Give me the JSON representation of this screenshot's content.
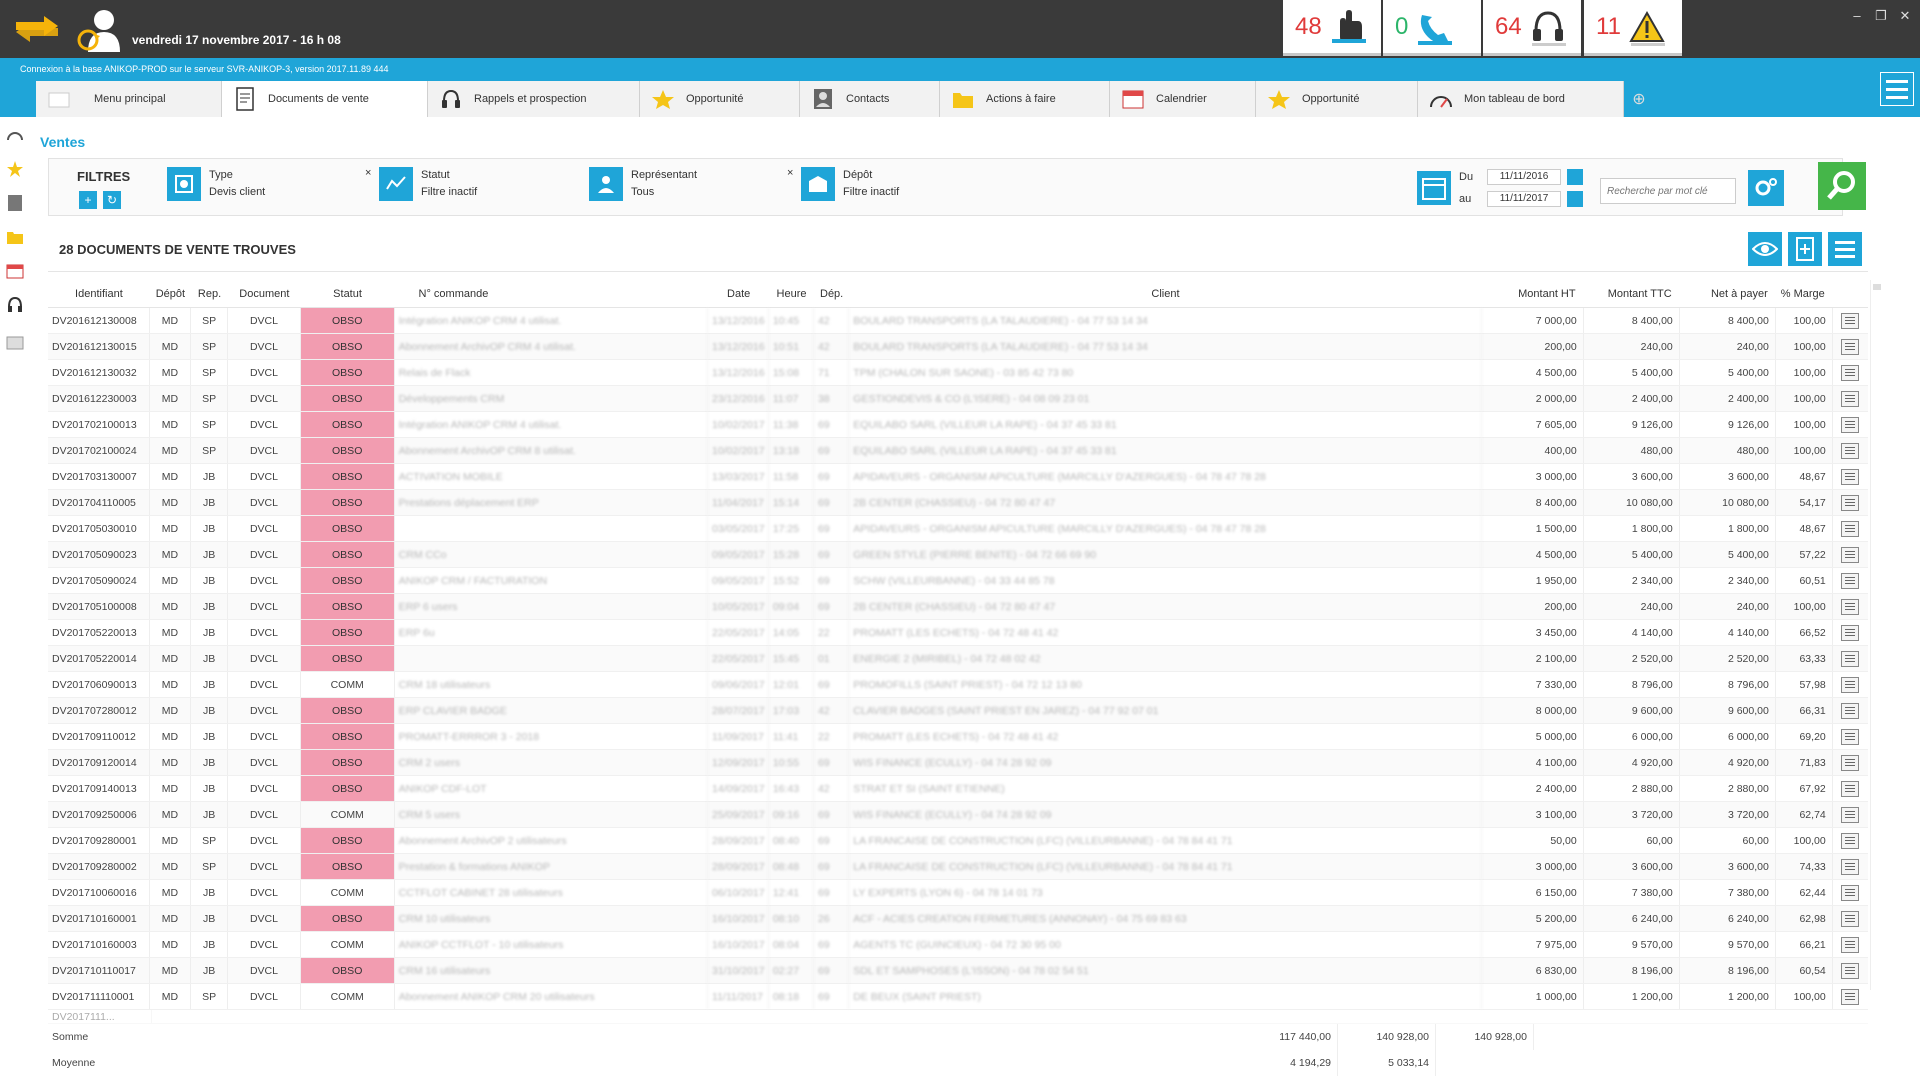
{
  "topbar": {
    "datetime": "vendredi 17 novembre 2017 - 16 h 08",
    "counters": [
      {
        "value": "48",
        "icon": "hand-icon",
        "color": "#e03a3a"
      },
      {
        "value": "0",
        "icon": "phone-icon",
        "color": "#2cb56a"
      },
      {
        "value": "64",
        "icon": "headset-icon",
        "color": "#e03a3a"
      },
      {
        "value": "11",
        "icon": "warning-icon",
        "color": "#e03a3a"
      }
    ]
  },
  "connection": "Connexion à la base ANIKOP-PROD sur le serveur SVR-ANIKOP-3, version 2017.11.89 444",
  "tabs": [
    {
      "label": "Menu principal",
      "icon": "home-icon"
    },
    {
      "label": "Documents de vente",
      "icon": "document-icon"
    },
    {
      "label": "Rappels et prospection",
      "icon": "headset-icon"
    },
    {
      "label": "Opportunité",
      "icon": "star-icon"
    },
    {
      "label": "Contacts",
      "icon": "contacts-icon"
    },
    {
      "label": "Actions à faire",
      "icon": "folder-icon"
    },
    {
      "label": "Calendrier",
      "icon": "calendar-icon"
    },
    {
      "label": "Opportunité",
      "icon": "star-icon"
    },
    {
      "label": "Mon tableau de bord",
      "icon": "gauge-icon"
    }
  ],
  "breadcrumb": "Ventes",
  "filters": {
    "label": "FILTRES",
    "type": {
      "title": "Type",
      "value": "Devis client"
    },
    "statut": {
      "title": "Statut",
      "value": "Filtre inactif"
    },
    "representant": {
      "title": "Représentant",
      "value": "Tous"
    },
    "depot": {
      "title": "Dépôt",
      "value": "Filtre inactif"
    },
    "du_label": "Du",
    "au_label": "au",
    "du": "11/11/2016",
    "au": "11/11/2017",
    "search_placeholder": "Recherche par mot clé"
  },
  "results_title": "28 DOCUMENTS DE VENTE TROUVES",
  "columns": [
    "Identifiant",
    "Dépôt",
    "Rep.",
    "Document",
    "Statut",
    "N° commande",
    "Date",
    "Heure",
    "Dép.",
    "Client",
    "Montant HT",
    "Montant TTC",
    "Net à payer",
    "% Marge"
  ],
  "rows": [
    {
      "id": "DV201612130008",
      "depot": "MD",
      "rep": "SP",
      "doc": "DVCL",
      "statut": "OBSO",
      "cmd": "Intégration ANIKOP CRM 4 utilisat.",
      "date": "13/12/2016",
      "heure": "10:45",
      "dept": "42",
      "client": "BOULARD TRANSPORTS (LA TALAUDIERE) - 04 77 53 14 34",
      "ht": "7 000,00",
      "ttc": "8 400,00",
      "net": "8 400,00",
      "marge": "100,00"
    },
    {
      "id": "DV201612130015",
      "depot": "MD",
      "rep": "SP",
      "doc": "DVCL",
      "statut": "OBSO",
      "cmd": "Abonnement ArchivOP CRM 4 utilisat.",
      "date": "13/12/2016",
      "heure": "10:51",
      "dept": "42",
      "client": "BOULARD TRANSPORTS (LA TALAUDIERE) - 04 77 53 14 34",
      "ht": "200,00",
      "ttc": "240,00",
      "net": "240,00",
      "marge": "100,00"
    },
    {
      "id": "DV201612130032",
      "depot": "MD",
      "rep": "SP",
      "doc": "DVCL",
      "statut": "OBSO",
      "cmd": "Relais de Flack",
      "date": "13/12/2016",
      "heure": "15:08",
      "dept": "71",
      "client": "TPM (CHALON SUR SAONE) - 03 85 42 73 80",
      "ht": "4 500,00",
      "ttc": "5 400,00",
      "net": "5 400,00",
      "marge": "100,00"
    },
    {
      "id": "DV201612230003",
      "depot": "MD",
      "rep": "SP",
      "doc": "DVCL",
      "statut": "OBSO",
      "cmd": "Développements CRM",
      "date": "23/12/2016",
      "heure": "11:07",
      "dept": "38",
      "client": "GESTIONDEVIS & CO (L'ISERE) - 04 08 09 23 01",
      "ht": "2 000,00",
      "ttc": "2 400,00",
      "net": "2 400,00",
      "marge": "100,00"
    },
    {
      "id": "DV201702100013",
      "depot": "MD",
      "rep": "SP",
      "doc": "DVCL",
      "statut": "OBSO",
      "cmd": "Intégration ANIKOP CRM 4 utilisat.",
      "date": "10/02/2017",
      "heure": "11:38",
      "dept": "69",
      "client": "EQUILABO SARL (VILLEUR LA RAPE) - 04 37 45 33 81",
      "ht": "7 605,00",
      "ttc": "9 126,00",
      "net": "9 126,00",
      "marge": "100,00"
    },
    {
      "id": "DV201702100024",
      "depot": "MD",
      "rep": "SP",
      "doc": "DVCL",
      "statut": "OBSO",
      "cmd": "Abonnement ArchivOP CRM 8 utilisat.",
      "date": "10/02/2017",
      "heure": "13:18",
      "dept": "69",
      "client": "EQUILABO SARL (VILLEUR LA RAPE) - 04 37 45 33 81",
      "ht": "400,00",
      "ttc": "480,00",
      "net": "480,00",
      "marge": "100,00"
    },
    {
      "id": "DV201703130007",
      "depot": "MD",
      "rep": "JB",
      "doc": "DVCL",
      "statut": "OBSO",
      "cmd": "ACTIVATION MOBILE",
      "date": "13/03/2017",
      "heure": "11:58",
      "dept": "69",
      "client": "APIDAVEURS - ORGANISM APICULTURE (MARCILLY D'AZERGUES) - 04 78 47 78 28",
      "ht": "3 000,00",
      "ttc": "3 600,00",
      "net": "3 600,00",
      "marge": "48,67"
    },
    {
      "id": "DV201704110005",
      "depot": "MD",
      "rep": "JB",
      "doc": "DVCL",
      "statut": "OBSO",
      "cmd": "Prestations déplacement ERP",
      "date": "11/04/2017",
      "heure": "15:14",
      "dept": "69",
      "client": "2B CENTER (CHASSIEU) - 04 72 80 47 47",
      "ht": "8 400,00",
      "ttc": "10 080,00",
      "net": "10 080,00",
      "marge": "54,17"
    },
    {
      "id": "DV201705030010",
      "depot": "MD",
      "rep": "JB",
      "doc": "DVCL",
      "statut": "OBSO",
      "cmd": "",
      "date": "03/05/2017",
      "heure": "17:25",
      "dept": "69",
      "client": "APIDAVEURS - ORGANISM APICULTURE (MARCILLY D'AZERGUES) - 04 78 47 78 28",
      "ht": "1 500,00",
      "ttc": "1 800,00",
      "net": "1 800,00",
      "marge": "48,67"
    },
    {
      "id": "DV201705090023",
      "depot": "MD",
      "rep": "JB",
      "doc": "DVCL",
      "statut": "OBSO",
      "cmd": "CRM CCo",
      "date": "09/05/2017",
      "heure": "15:28",
      "dept": "69",
      "client": "GREEN STYLE (PIERRE BENITE) - 04 72 66 69 90",
      "ht": "4 500,00",
      "ttc": "5 400,00",
      "net": "5 400,00",
      "marge": "57,22"
    },
    {
      "id": "DV201705090024",
      "depot": "MD",
      "rep": "JB",
      "doc": "DVCL",
      "statut": "OBSO",
      "cmd": "ANIKOP CRM / FACTURATION",
      "date": "09/05/2017",
      "heure": "15:52",
      "dept": "69",
      "client": "SCHW (VILLEURBANNE) - 04 33 44 85 78",
      "ht": "1 950,00",
      "ttc": "2 340,00",
      "net": "2 340,00",
      "marge": "60,51"
    },
    {
      "id": "DV201705100008",
      "depot": "MD",
      "rep": "JB",
      "doc": "DVCL",
      "statut": "OBSO",
      "cmd": "ERP 6 users",
      "date": "10/05/2017",
      "heure": "09:04",
      "dept": "69",
      "client": "2B CENTER (CHASSIEU) - 04 72 80 47 47",
      "ht": "200,00",
      "ttc": "240,00",
      "net": "240,00",
      "marge": "100,00"
    },
    {
      "id": "DV201705220013",
      "depot": "MD",
      "rep": "JB",
      "doc": "DVCL",
      "statut": "OBSO",
      "cmd": "ERP 6u",
      "date": "22/05/2017",
      "heure": "14:05",
      "dept": "22",
      "client": "PROMATT (LES ECHETS) - 04 72 48 41 42",
      "ht": "3 450,00",
      "ttc": "4 140,00",
      "net": "4 140,00",
      "marge": "66,52"
    },
    {
      "id": "DV201705220014",
      "depot": "MD",
      "rep": "JB",
      "doc": "DVCL",
      "statut": "OBSO",
      "cmd": "",
      "date": "22/05/2017",
      "heure": "15:45",
      "dept": "01",
      "client": "ENERGIE 2 (MIRIBEL) - 04 72 48 02 42",
      "ht": "2 100,00",
      "ttc": "2 520,00",
      "net": "2 520,00",
      "marge": "63,33"
    },
    {
      "id": "DV201706090013",
      "depot": "MD",
      "rep": "JB",
      "doc": "DVCL",
      "statut": "COMM",
      "cmd": "CRM 18 utilisateurs",
      "date": "09/06/2017",
      "heure": "12:01",
      "dept": "69",
      "client": "PROMOFILLS (SAINT PRIEST) - 04 72 12 13 80",
      "ht": "7 330,00",
      "ttc": "8 796,00",
      "net": "8 796,00",
      "marge": "57,98"
    },
    {
      "id": "DV201707280012",
      "depot": "MD",
      "rep": "JB",
      "doc": "DVCL",
      "statut": "OBSO",
      "cmd": "ERP CLAVIER BADGE",
      "date": "28/07/2017",
      "heure": "17:03",
      "dept": "42",
      "client": "CLAVIER BADGES (SAINT PRIEST EN JAREZ) - 04 77 92 07 01",
      "ht": "8 000,00",
      "ttc": "9 600,00",
      "net": "9 600,00",
      "marge": "66,31"
    },
    {
      "id": "DV201709110012",
      "depot": "MD",
      "rep": "JB",
      "doc": "DVCL",
      "statut": "OBSO",
      "cmd": "PROMATT-ERRROR 3 - 2018",
      "date": "11/09/2017",
      "heure": "11:41",
      "dept": "22",
      "client": "PROMATT (LES ECHETS) - 04 72 48 41 42",
      "ht": "5 000,00",
      "ttc": "6 000,00",
      "net": "6 000,00",
      "marge": "69,20"
    },
    {
      "id": "DV201709120014",
      "depot": "MD",
      "rep": "JB",
      "doc": "DVCL",
      "statut": "OBSO",
      "cmd": "CRM 2 users",
      "date": "12/09/2017",
      "heure": "10:55",
      "dept": "69",
      "client": "WIS FINANCE (ECULLY) - 04 74 28 92 09",
      "ht": "4 100,00",
      "ttc": "4 920,00",
      "net": "4 920,00",
      "marge": "71,83"
    },
    {
      "id": "DV201709140013",
      "depot": "MD",
      "rep": "JB",
      "doc": "DVCL",
      "statut": "OBSO",
      "cmd": "ANIKOP CDF-LOT",
      "date": "14/09/2017",
      "heure": "16:43",
      "dept": "42",
      "client": "STRAT ET SI (SAINT ETIENNE)",
      "ht": "2 400,00",
      "ttc": "2 880,00",
      "net": "2 880,00",
      "marge": "67,92"
    },
    {
      "id": "DV201709250006",
      "depot": "MD",
      "rep": "JB",
      "doc": "DVCL",
      "statut": "COMM",
      "cmd": "CRM 5 users",
      "date": "25/09/2017",
      "heure": "09:16",
      "dept": "69",
      "client": "WIS FINANCE (ECULLY) - 04 74 28 92 09",
      "ht": "3 100,00",
      "ttc": "3 720,00",
      "net": "3 720,00",
      "marge": "62,74"
    },
    {
      "id": "DV201709280001",
      "depot": "MD",
      "rep": "SP",
      "doc": "DVCL",
      "statut": "OBSO",
      "cmd": "Abonnement ArchivOP 2 utilisateurs",
      "date": "28/09/2017",
      "heure": "08:40",
      "dept": "69",
      "client": "LA FRANCAISE DE CONSTRUCTION (LFC) (VILLEURBANNE) - 04 78 84 41 71",
      "ht": "50,00",
      "ttc": "60,00",
      "net": "60,00",
      "marge": "100,00"
    },
    {
      "id": "DV201709280002",
      "depot": "MD",
      "rep": "SP",
      "doc": "DVCL",
      "statut": "OBSO",
      "cmd": "Prestation & formations ANIKOP",
      "date": "28/09/2017",
      "heure": "08:48",
      "dept": "69",
      "client": "LA FRANCAISE DE CONSTRUCTION (LFC) (VILLEURBANNE) - 04 78 84 41 71",
      "ht": "3 000,00",
      "ttc": "3 600,00",
      "net": "3 600,00",
      "marge": "74,33"
    },
    {
      "id": "DV201710060016",
      "depot": "MD",
      "rep": "JB",
      "doc": "DVCL",
      "statut": "COMM",
      "cmd": "CCTFLOT CABINET 28 utilisateurs",
      "date": "06/10/2017",
      "heure": "12:41",
      "dept": "69",
      "client": "LY EXPERTS (LYON 6) - 04 78 14 01 73",
      "ht": "6 150,00",
      "ttc": "7 380,00",
      "net": "7 380,00",
      "marge": "62,44"
    },
    {
      "id": "DV201710160001",
      "depot": "MD",
      "rep": "JB",
      "doc": "DVCL",
      "statut": "OBSO",
      "cmd": "CRM 10 utilisateurs",
      "date": "16/10/2017",
      "heure": "08:10",
      "dept": "26",
      "client": "ACF - ACIES CREATION FERMETURES (ANNONAY) - 04 75 69 83 63",
      "ht": "5 200,00",
      "ttc": "6 240,00",
      "net": "6 240,00",
      "marge": "62,98"
    },
    {
      "id": "DV201710160003",
      "depot": "MD",
      "rep": "JB",
      "doc": "DVCL",
      "statut": "COMM",
      "cmd": "ANIKOP CCTFLOT - 10 utilisateurs",
      "date": "16/10/2017",
      "heure": "08:04",
      "dept": "69",
      "client": "AGENTS TC (GUINCIEUX) - 04 72 30 95 00",
      "ht": "7 975,00",
      "ttc": "9 570,00",
      "net": "9 570,00",
      "marge": "66,21"
    },
    {
      "id": "DV201710110017",
      "depot": "MD",
      "rep": "JB",
      "doc": "DVCL",
      "statut": "OBSO",
      "cmd": "CRM 16 utilisateurs",
      "date": "31/10/2017",
      "heure": "02:27",
      "dept": "69",
      "client": "SDL ET SAMPHOSES (L'ISSON) - 04 78 02 54 51",
      "ht": "6 830,00",
      "ttc": "8 196,00",
      "net": "8 196,00",
      "marge": "60,54"
    },
    {
      "id": "DV201711110001",
      "depot": "MD",
      "rep": "SP",
      "doc": "DVCL",
      "statut": "COMM",
      "cmd": "Abonnement ANIKOP CRM 20 utilisateurs",
      "date": "11/11/2017",
      "heure": "08:18",
      "dept": "69",
      "client": "DE BEUX (SAINT PRIEST)",
      "ht": "1 000,00",
      "ttc": "1 200,00",
      "net": "1 200,00",
      "marge": "100,00"
    }
  ],
  "footer": {
    "somme_label": "Somme",
    "moyenne_label": "Moyenne",
    "somme_ht": "117 440,00",
    "somme_ttc": "140 928,00",
    "somme_net": "140 928,00",
    "moyenne_ht": "4 194,29",
    "moyenne_ttc": "5 033,14"
  },
  "colors": {
    "accent": "#1fa5d8",
    "obso": "#f29cb0",
    "search": "#45b649",
    "counter_red": "#e03a3a",
    "counter_green": "#2cb56a"
  }
}
